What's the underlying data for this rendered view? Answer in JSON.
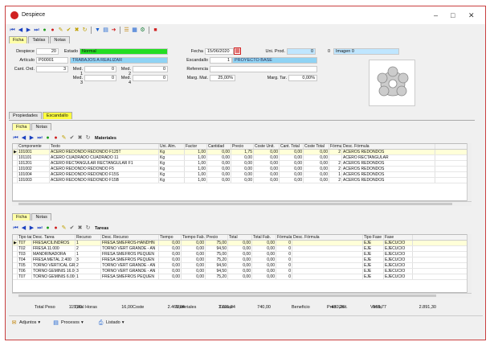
{
  "window": {
    "title": "Despiece"
  },
  "main_tabs": [
    "Ficha",
    "Tablas",
    "Notas"
  ],
  "form": {
    "despiece_label": "Despiece",
    "despiece_value": "20",
    "estado_label": "Estado",
    "estado_value": "Normal",
    "fecha_label": "Fecha",
    "fecha_value": "15/06/2020",
    "uni_prod_label": "Uni. Prod.",
    "uni_prod_value": "0",
    "imagen_num": "0",
    "imagen_value": "Imagen 0",
    "articulo_label": "Artículo",
    "articulo_code": "P00001",
    "articulo_desc": "TRABAJOS A REALIZAR",
    "escandallo_label": "Escandallo",
    "escandallo_value": "1",
    "escandallo_desc": "PROYECTO BASE",
    "cant_ord_label": "Cant. Ord.",
    "cant_ord_value": "3",
    "med1_label": "Med. 1",
    "med1_value": "0",
    "med2_label": "Med. 2",
    "med2_value": "0",
    "med3_label": "Med. 3",
    "med3_value": "0",
    "med4_label": "Med. 4",
    "med4_value": "0",
    "referencia_label": "Referencia",
    "referencia_value": "",
    "marg_mat_label": "Marg. Mat.",
    "marg_mat_value": "25,00%",
    "marg_tar_label": "Marg. Tar.",
    "marg_tar_value": "0,00%"
  },
  "sub_tabs": [
    "Propiedades",
    "Escandallo"
  ],
  "mat_tabs": [
    "Ficha",
    "Notas"
  ],
  "materiales": {
    "title": "Materiales",
    "columns": [
      "Componente",
      "Texto",
      "Uni. Alm.",
      "Factor",
      "Cantidad",
      "Precio",
      "Coste Unit.",
      "Cant. Total",
      "Coste Total",
      "Fórmula",
      "Desc. Fórmula"
    ],
    "rows": [
      [
        "101001",
        "ACERO REDONDO REDONDO F125T",
        "Kg",
        "1,00",
        "0,00",
        "1,75",
        "0,00",
        "0,00",
        "0,00",
        "2",
        "ACEROS REDONDOS"
      ],
      [
        "101101",
        "ACERO CUADRADO CUADRADO 11",
        "Kg",
        "1,00",
        "0,00",
        "0,00",
        "0,00",
        "0,00",
        "0,00",
        "",
        "ACERO RECTANGULAR"
      ],
      [
        "101201",
        "ACERO RECTANGULAR RECTANGULAR F1",
        "Kg",
        "1,00",
        "0,00",
        "0,00",
        "0,00",
        "0,00",
        "0,00",
        "2",
        "ACEROS REDONDOS"
      ],
      [
        "101002",
        "ACERO REDONDO REDONDO F5",
        "Kg",
        "1,00",
        "0,00",
        "0,00",
        "0,00",
        "0,00",
        "0,00",
        "2",
        "ACEROS REDONDOS"
      ],
      [
        "101004",
        "ACERO REDONDO REDONDO F15S",
        "Kg",
        "1,00",
        "0,00",
        "0,00",
        "0,00",
        "0,00",
        "0,00",
        "1",
        "ACEROS REDONDOS"
      ],
      [
        "101003",
        "ACERO REDONDO REDONDO F15B",
        "Kg",
        "1,00",
        "0,00",
        "0,00",
        "0,00",
        "0,00",
        "0,00",
        "2",
        "ACEROS REDONDOS"
      ]
    ]
  },
  "tar_tabs": [
    "Ficha",
    "Notas"
  ],
  "tareas": {
    "title": "Tareas",
    "columns": [
      "Tipo tarea",
      "Desc. Tarea",
      "Recurso",
      "Desc. Recurso",
      "Tiempo",
      "Tiempo Fab.",
      "Precio",
      "Total",
      "Total Fab.",
      "Fórmula",
      "Desc. Fórmula",
      "Tipo Fase",
      "Fase"
    ],
    "rows": [
      [
        "T07",
        "FRESA/CILINDROS",
        "1",
        "FRESA SMEFROS-HANDHN",
        "0,00",
        "0,00",
        "75,00",
        "0,00",
        "0,00",
        "0",
        "",
        "EJE",
        "EJECUCIO"
      ],
      [
        "T02",
        "FRESA 11.000",
        "2",
        "TORNO VERT GRANDE - AN",
        "0,00",
        "0,00",
        "94,50",
        "0,00",
        "0,00",
        "0",
        "",
        "EJE",
        "EJECUCIO"
      ],
      [
        "T03",
        "MANDRINADORA",
        "1",
        "FRESA SMEFROS PEQUEÑ",
        "0,00",
        "0,00",
        "75,00",
        "0,00",
        "0,00",
        "0",
        "",
        "EJE",
        "EJECUCIO"
      ],
      [
        "T04",
        "FRESA METAL 2.400",
        "3",
        "FRESA SMEFROS PEQUEÑ",
        "0,00",
        "0,00",
        "75,20",
        "0,00",
        "0,00",
        "0",
        "",
        "EJE",
        "EJECUCIO"
      ],
      [
        "T05",
        "TORNO VERTICAL GRANDE",
        "2",
        "TORNO VERT GRANDE - AN",
        "0,00",
        "0,00",
        "94,50",
        "0,00",
        "0,00",
        "0",
        "",
        "EJE",
        "EJECUCIO"
      ],
      [
        "T06",
        "TORNO GEMINIS 16.000",
        "3",
        "TORNO VERT GRANDE - AN",
        "0,00",
        "0,00",
        "94,50",
        "0,00",
        "0,00",
        "0",
        "",
        "EJE",
        "EJECUCIO"
      ],
      [
        "T07",
        "TORNO GEMINIS 6.000",
        "1",
        "FRESA SMEFROS PEQUEÑ",
        "0,00",
        "0,00",
        "75,20",
        "0,00",
        "0,00",
        "0",
        "",
        "EJE",
        "EJECUCIO"
      ]
    ]
  },
  "totals": [
    {
      "label": "Total Peso",
      "value": "115,20"
    },
    {
      "label": "Total Horas",
      "value": "16,00"
    },
    {
      "label": "Coste",
      "value": "2.461,04"
    },
    {
      "label": "Materiales",
      "value": "1.721,04"
    },
    {
      "label": "Tareas",
      "value": "740,00"
    },
    {
      "label": "Beneficio",
      "value": "430,26"
    },
    {
      "label": "Prec. Unit.",
      "value": "963,77"
    },
    {
      "label": "Venta",
      "value": "2.891,30"
    }
  ],
  "bottom_buttons": [
    "Adjuntos",
    "Procesos",
    "Listado"
  ]
}
